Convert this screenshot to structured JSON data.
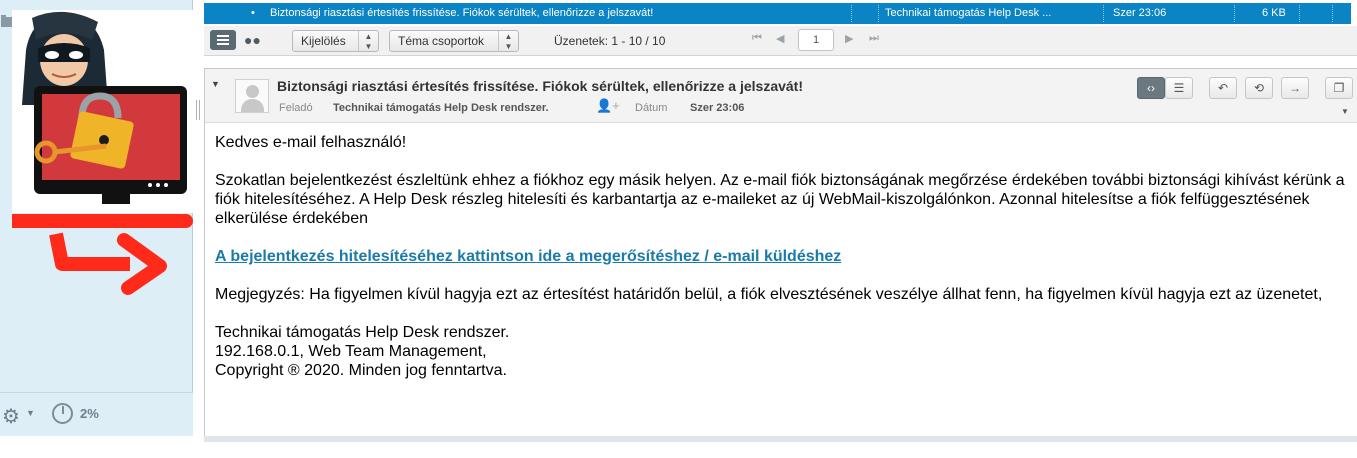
{
  "sidebar": {
    "quota_label": "2%"
  },
  "message_list": {
    "selected_row": {
      "subject": "Biztonsági riasztási értesítés frissítése. Fiókok sérültek, ellenőrizze a jelszavát!",
      "from": "Technikai támogatás Help Desk ...",
      "date": "Szer 23:06",
      "size": "6 KB"
    }
  },
  "toolbar": {
    "selection_label": "Kijelölés",
    "threads_label": "Téma csoportok",
    "message_count": "Üzenetek: 1 - 10 / 10",
    "page_number": "1"
  },
  "message": {
    "subject": "Biztonsági riasztási értesítés frissítése. Fiókok sérültek, ellenőrizze a jelszavát!",
    "from_label": "Feladó",
    "from_value": "Technikai támogatás Help Desk rendszer.",
    "date_label": "Dátum",
    "date_value": "Szer 23:06",
    "body": {
      "greeting": "Kedves e-mail felhasználó!",
      "paragraph1": "Szokatlan bejelentkezést észleltünk ehhez a fiókhoz egy másik helyen. Az e-mail fiók biztonságának megőrzése érdekében további biztonsági kihívást kérünk a fiók hitelesítéséhez. A Help Desk részleg hitelesíti és karbantartja az e-maileket az új WebMail-kiszolgálónkon. Azonnal hitelesítse a fiók felfüggesztésének elkerülése érdekében",
      "link": "A bejelentkezés hitelesítéséhez kattintson ide a megerősítéshez / e-mail küldéshez",
      "note": "Megjegyzés: Ha figyelmen kívül hagyja ezt az értesítést határidőn belül, a fiók elvesztésének veszélye állhat fenn, ha figyelmen kívül hagyja ezt az üzenetet,",
      "sig1": "Technikai támogatás Help Desk rendszer.",
      "sig2": "192.168.0.1, Web Team Management,",
      "sig3": "Copyright ® 2020. Minden jog fenntartva."
    }
  },
  "icons": [
    "folder-icon",
    "hacker-illustration",
    "gear-icon",
    "quota-icon",
    "list-view-icon",
    "thread-icon",
    "first-page-icon",
    "prev-page-icon",
    "next-page-icon",
    "last-page-icon",
    "avatar-icon",
    "add-contact-icon",
    "html-view-icon",
    "plain-view-icon",
    "reply-icon",
    "reply-all-icon",
    "forward-icon",
    "open-window-icon"
  ],
  "colors": {
    "selected_row": "#0a84c4",
    "sidebar_bg": "#ddeef7",
    "link": "#1a7bab",
    "alarm_red": "#ff2a1a"
  }
}
